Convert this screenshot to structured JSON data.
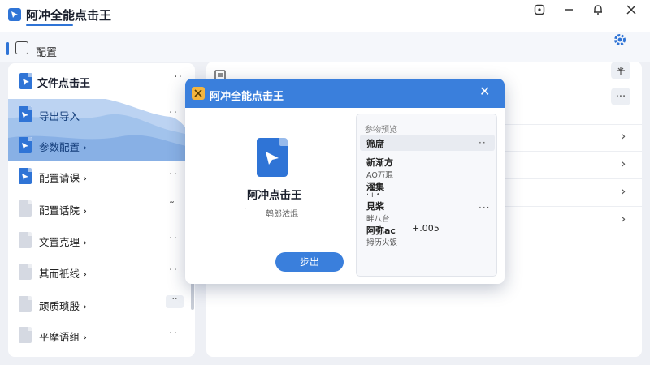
{
  "app": {
    "title": "阿冲全能点击王"
  },
  "window_controls": {
    "pin": "⊡",
    "minimize": "−",
    "notify": "🔔",
    "close": "✕"
  },
  "subheader": {
    "title": "配置"
  },
  "sidebar": {
    "header": {
      "label": "文件点击王",
      "more": "··"
    },
    "items": [
      {
        "label": "导出导入",
        "more": "··",
        "suffix": "›"
      },
      {
        "label": "参数配置",
        "suffix": "›"
      },
      {
        "label": "配置请课",
        "suffix": "›",
        "more": "··"
      },
      {
        "label": "配置话院",
        "suffix": "›",
        "more": "˜"
      },
      {
        "label": "文置克理",
        "suffix": "›",
        "more": "··"
      },
      {
        "label": "其而祇线",
        "suffix": "›",
        "more": "··"
      },
      {
        "label": "顽质琐殷",
        "suffix": "›",
        "more": "··"
      },
      {
        "label": "平摩语组",
        "suffix": "›",
        "more": "··"
      }
    ]
  },
  "main": {
    "more": "···",
    "chevron": "›",
    "overlay_text": "t"
  },
  "modal": {
    "title": "阿冲全能点击王",
    "close": "✕",
    "app_name": "阿冲点击王",
    "sub_dot": "·",
    "subtitle": "鹎郎浓焜",
    "button": "步出",
    "preview": {
      "title": "参物预览",
      "rows": [
        {
          "label": "筛席",
          "more": "··"
        },
        {
          "label": "新渐方"
        },
        {
          "label": "AO万琨",
          "small": true
        },
        {
          "label": "濯集",
          "extra": "·  ı  •"
        },
        {
          "label": "見桨"
        },
        {
          "label": "畔八台",
          "small": true
        },
        {
          "label": "阿弥ac",
          "extra": "+.005"
        },
        {
          "label": "拇历火饭",
          "small": true
        }
      ],
      "right_more": "···"
    }
  },
  "colors": {
    "accent": "#2f74d6",
    "modal_header": "#3a7fdc",
    "background": "#eef0f5"
  }
}
